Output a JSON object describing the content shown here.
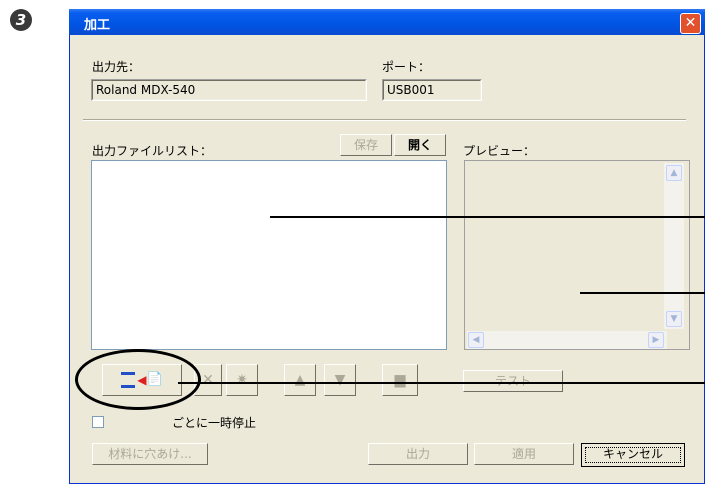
{
  "step_number": "3",
  "window": {
    "title": "加工",
    "close_glyph": "✕"
  },
  "output_destination": {
    "label": "出力先：",
    "value": "Roland MDX-540"
  },
  "port": {
    "label": "ポート：",
    "value": "USB001"
  },
  "file_list": {
    "label": "出力ファイルリスト：",
    "save_button": "保存",
    "open_button": "開く"
  },
  "preview": {
    "label": "プレビュー：",
    "scroll_up": "▲",
    "scroll_down": "▼",
    "scroll_left": "◀",
    "scroll_right": "▶"
  },
  "toolbar": {
    "add_icon": "📄",
    "star_icon": "✷",
    "up_icon": "▲",
    "down_icon": "▼",
    "doc_icon": "▆",
    "test_button": "テスト"
  },
  "pause_checkbox": {
    "label_partial": "ごとに一時停止"
  },
  "footer": {
    "drill_button": "材料に穴あけ...",
    "output_button": "出力",
    "apply_button": "適用",
    "cancel_button": "キャンセル"
  },
  "colors": {
    "titlebar": "#0054e3",
    "close": "#e2502c",
    "dialog_bg": "#ece9d8",
    "callout": "#000000"
  }
}
